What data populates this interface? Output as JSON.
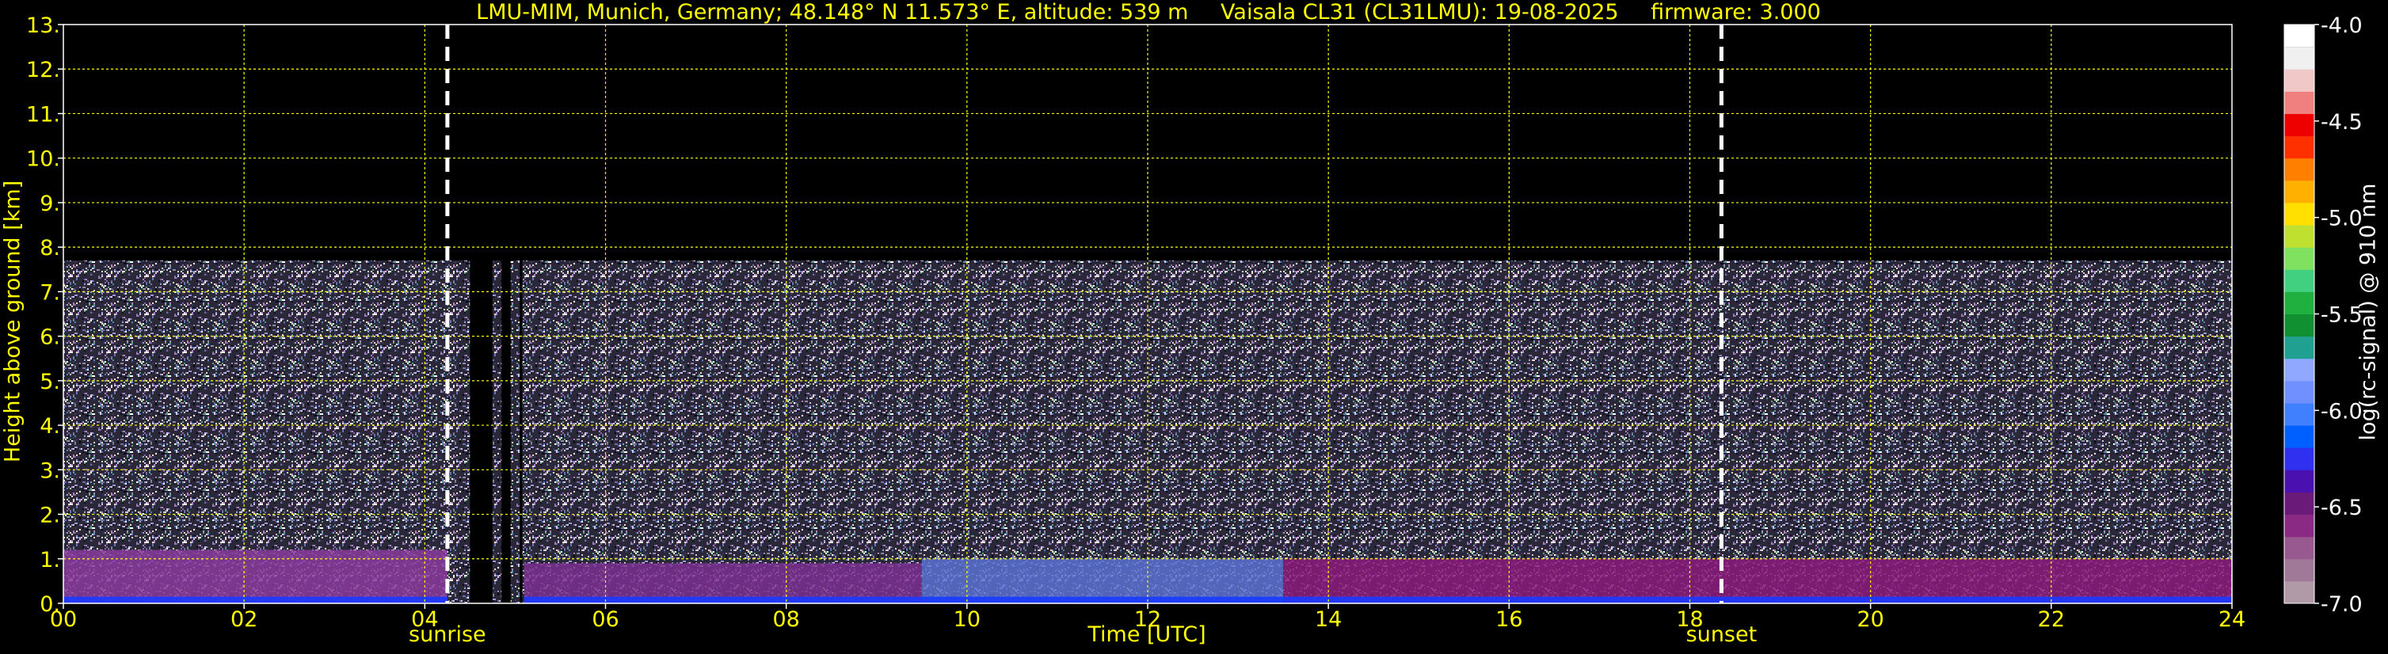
{
  "header": {
    "site": "LMU-MIM, Munich, Germany; 48.148° N 11.573° E, altitude: 539 m",
    "instrument": "Vaisala CL31 (CL31LMU): 19-08-2025",
    "firmware": "firmware: 3.000"
  },
  "chart_data": {
    "type": "heatmap",
    "title": "LMU-MIM, Munich, Germany; 48.148° N 11.573° E, altitude: 539 m    Vaisala CL31 (CL31LMU): 19-08-2025    firmware: 3.000",
    "xlabel": "Time [UTC]",
    "ylabel": "Height above ground [km]",
    "xlim": [
      0,
      24
    ],
    "ylim": [
      0,
      13
    ],
    "x_ticks": [
      0,
      2,
      4,
      6,
      8,
      10,
      12,
      14,
      16,
      18,
      20,
      22,
      24
    ],
    "x_tick_labels": [
      "00",
      "02",
      "04",
      "06",
      "08",
      "10",
      "12",
      "14",
      "16",
      "18",
      "20",
      "22",
      "24"
    ],
    "y_ticks": [
      0,
      1,
      2,
      3,
      4,
      5,
      6,
      7,
      8,
      9,
      10,
      11,
      12,
      13
    ],
    "y_tick_labels": [
      "0.",
      "1.",
      "2.",
      "3.",
      "4.",
      "5.",
      "6.",
      "7.",
      "8.",
      "9.",
      "10.",
      "11.",
      "12.",
      "13."
    ],
    "grid": true,
    "grid_color": "#ffff00",
    "data_top_km": 7.7,
    "events": [
      {
        "name": "sunrise",
        "time": 4.25
      },
      {
        "name": "sunset",
        "time": 18.35
      }
    ],
    "data_gaps": [
      {
        "start": 4.5,
        "end": 4.75
      },
      {
        "start": 4.85,
        "end": 4.95
      },
      {
        "start": 5.05,
        "end": 5.08
      }
    ],
    "colorbar": {
      "label": "log(rc-signal) @ 910 nm",
      "range": [
        -7.0,
        -4.0
      ],
      "ticks": [
        -7.0,
        -6.5,
        -6.0,
        -5.5,
        -5.0,
        -4.5,
        -4.0
      ],
      "tick_labels": [
        "-7.0",
        "-6.5",
        "-6.0",
        "-5.5",
        "-5.0",
        "-4.5",
        "-4.0"
      ],
      "colors": [
        "#b09aa8",
        "#a07898",
        "#985890",
        "#8a2a85",
        "#6a1a78",
        "#4a10b0",
        "#3030f0",
        "#0060ff",
        "#4080ff",
        "#7090ff",
        "#90a8ff",
        "#20a090",
        "#109030",
        "#20b040",
        "#40d080",
        "#80e060",
        "#c0e030",
        "#ffe000",
        "#ffb000",
        "#ff8000",
        "#ff3000",
        "#ee0000",
        "#f08080",
        "#f0c8c8",
        "#f0f0f0",
        "#ffffff"
      ]
    },
    "boundary_layer": [
      {
        "start": 0,
        "end": 4.25,
        "top_km": 1.2,
        "color": "#8a3a9a"
      },
      {
        "start": 5.1,
        "end": 9.5,
        "top_km": 0.9,
        "color": "#7a3090"
      },
      {
        "start": 9.5,
        "end": 13.5,
        "top_km": 1.0,
        "color": "#5a70d0"
      },
      {
        "start": 13.5,
        "end": 24,
        "top_km": 1.0,
        "color": "#8a1a7a"
      }
    ]
  }
}
